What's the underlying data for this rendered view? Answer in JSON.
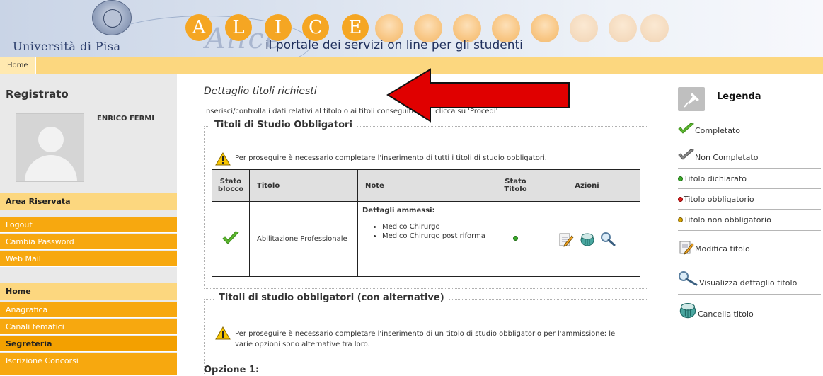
{
  "header": {
    "university_name": "Università di Pisa",
    "alice_letters": [
      "A",
      "L",
      "I",
      "C",
      "E"
    ],
    "alice_script": "Alice",
    "tagline": "il portale dei servizi on line per gli studenti"
  },
  "breadcrumb": {
    "home": "Home"
  },
  "sidebar": {
    "title": "Registrato",
    "user_name": "ENRICO FERMI",
    "area_riservata": {
      "heading": "Area Riservata",
      "items": [
        "Logout",
        "Cambia Password",
        "Web Mail"
      ]
    },
    "home_section": {
      "heading": "Home",
      "items": [
        "Anagrafica",
        "Canali tematici"
      ],
      "segreteria": "Segreteria",
      "segreteria_items": [
        "Iscrizione Concorsi"
      ]
    }
  },
  "main": {
    "title": "Dettaglio titoli richiesti",
    "intro": "Inserisci/controlla i dati relativi al titolo o ai titoli conseguiti e poi clicca su 'Procedi'",
    "section1": {
      "legend": "Titoli di Studio Obbligatori",
      "warning": "Per proseguire è necessario completare l'inserimento di tutti i titoli di studio obbligatori.",
      "table": {
        "headers": [
          "Stato blocco",
          "Titolo",
          "Note",
          "Stato Titolo",
          "Azioni"
        ],
        "row": {
          "titolo": "Abilitazione Professionale",
          "note_heading": "Dettagli ammessi:",
          "note_items": [
            "Medico Chirurgo",
            "Medico Chirurgo post riforma"
          ]
        }
      }
    },
    "section2": {
      "legend": "Titoli di studio obbligatori (con alternative)",
      "warning": "Per proseguire è necessario completare l'inserimento di un titolo di studio obbligatorio per l'ammissione; le varie opzioni sono alternative tra loro.",
      "option": "Opzione 1:"
    }
  },
  "legend": {
    "title": "Legenda",
    "items": {
      "completato": "Completato",
      "non_completato": "Non Completato",
      "titolo_dichiarato": "Titolo dichiarato",
      "titolo_obbligatorio": "Titolo obbligatorio",
      "titolo_non_obbligatorio": "Titolo non obbligatorio",
      "modifica": "Modifica titolo",
      "visualizza": "Visualizza dettaglio titolo",
      "cancella": "Cancella titolo"
    }
  },
  "colors": {
    "orange_menu": "#f7a80f",
    "light_orange": "#fcd77f",
    "alice_orange": "#f5a623",
    "green_check": "#5cb82e",
    "green_dot": "#3aaa2a",
    "red_dot": "#e02020",
    "yellow_dot": "#d9a400",
    "annotation_arrow": "#e00000"
  },
  "icons": {
    "warning": "warning-icon",
    "check_done": "check-green-icon",
    "check_todo": "check-gray-icon",
    "edit": "edit-pencil-icon",
    "delete": "trash-bin-icon",
    "view": "magnifier-icon",
    "pin": "pin-icon"
  }
}
